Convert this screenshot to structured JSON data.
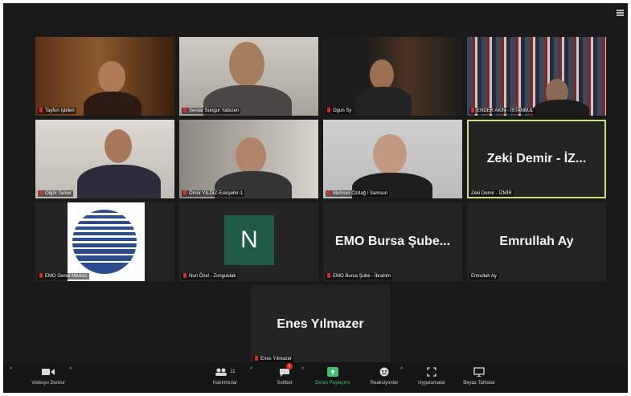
{
  "participants": [
    {
      "name": "Tayfun Işbilen"
    },
    {
      "name": "Serdar Sungur Yabızen"
    },
    {
      "name": "Ogun Sy"
    },
    {
      "name": "ENDER AKIN - İSTANBUL"
    },
    {
      "name": "Olgür Tamer"
    },
    {
      "name": "Ömür YILDIZ-Eskişehir-1"
    },
    {
      "name": "Mehmet Özdağ / Samsun"
    },
    {
      "name": "Zeki Demir - İZMİR",
      "display": "Zeki Demir - İZ..."
    },
    {
      "name": "EMO Genel Merkez"
    },
    {
      "name": "Nuri Özel - Zonguldak",
      "avatar_letter": "N"
    },
    {
      "name": "EMO Bursa Şube - İbrahim",
      "display": "EMO Bursa Şube..."
    },
    {
      "name": "Emrullah Ay",
      "display": "Emrullah Ay"
    },
    {
      "name": "Enes Yılmazer",
      "display": "Enes Yılmazer"
    }
  ],
  "toolbar": {
    "video": "Videoyu Durdur",
    "participants": "Katılımcılar",
    "participants_count": "11",
    "chat": "Sohbet",
    "chat_badge": "1",
    "share": "Ekran Paylaşımı",
    "reactions": "Reaksiyonlar",
    "apps": "Uygulamalar",
    "whiteboard": "Beyaz Tahtalar"
  },
  "colors": {
    "active_speaker": "#c6e27e",
    "share": "#3fbf6b",
    "avatar_bg": "#1e5c45"
  }
}
